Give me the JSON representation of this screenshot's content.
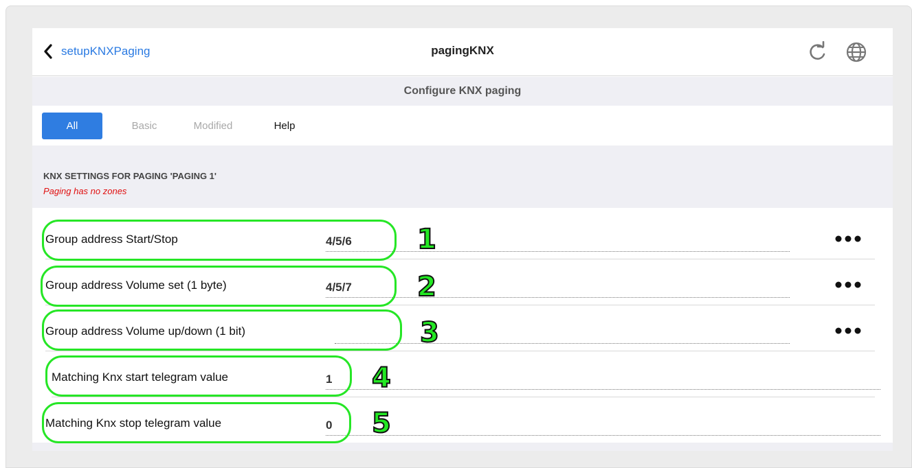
{
  "header": {
    "back_label": "setupKNXPaging",
    "title": "pagingKNX",
    "icons": [
      "chevron-left-icon",
      "refresh-icon",
      "globe-icon"
    ]
  },
  "subheader": {
    "title": "Configure KNX paging"
  },
  "tabs": [
    {
      "label": "All",
      "active": true
    },
    {
      "label": "Basic",
      "active": false
    },
    {
      "label": "Modified",
      "active": false
    },
    {
      "label": "Help",
      "active": false
    }
  ],
  "section": {
    "title": "KNX SETTINGS FOR PAGING 'PAGING 1'",
    "note": "Paging has no zones"
  },
  "rows": [
    {
      "label": "Group address Start/Stop",
      "value": "4/5/6",
      "has_more": true
    },
    {
      "label": "Group address Volume set (1 byte)",
      "value": "4/5/7",
      "has_more": true
    },
    {
      "label": "Group address Volume up/down (1 bit)",
      "value": "",
      "has_more": true
    },
    {
      "label": "Matching Knx start telegram value",
      "value": "1",
      "has_more": false
    },
    {
      "label": "Matching Knx stop telegram value",
      "value": "0",
      "has_more": false
    }
  ],
  "annotations": [
    "1",
    "2",
    "3",
    "4",
    "5"
  ],
  "colors": {
    "accent": "#2f7de1",
    "link": "#2a7ae2",
    "warning": "#e01010",
    "annotation": "#23e823"
  }
}
